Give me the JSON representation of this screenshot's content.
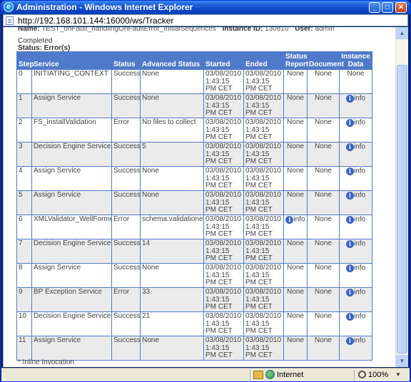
{
  "window": {
    "title": "Administration - Windows Internet Explorer",
    "url": "http://192.168.101.144:16000/ws/Tracker"
  },
  "header": {
    "name_label": "Name:",
    "name_value": "TEST_onFault_handlingOnFaultError_InitialSequences",
    "instance_label": "Instance ID:",
    "instance_value": "130810",
    "user_label": "User:",
    "user_value": "admin",
    "completed": "Completed",
    "status": "Status: Error(s)"
  },
  "table": {
    "columns": [
      "Step",
      "Service",
      "Status",
      "Advanced Status",
      "Started",
      "Ended",
      "Status Report",
      "Document",
      "Instance Data"
    ],
    "rows": [
      {
        "step": "0",
        "service": "INITIATING_CONTEXT",
        "status": "Success",
        "advanced": "None",
        "started": "03/08/2010 1:43:15 PM CET",
        "ended": "03/08/2010 1:43:15 PM CET",
        "report": "None",
        "document": "None",
        "instance": "None"
      },
      {
        "step": "1",
        "service": "Assign Service",
        "status": "Success",
        "advanced": "None",
        "started": "03/08/2010 1:43:15 PM CET",
        "ended": "03/08/2010 1:43:15 PM CET",
        "report": "None",
        "document": "None",
        "instance": "info"
      },
      {
        "step": "2",
        "service": "FS_InstallValidation",
        "status": "Error",
        "advanced": "No files to collect",
        "started": "03/08/2010 1:43:15 PM CET",
        "ended": "03/08/2010 1:43:15 PM CET",
        "report": "None",
        "document": "None",
        "instance": "info"
      },
      {
        "step": "3",
        "service": "Decision Engine Service",
        "status": "Success",
        "advanced": "5",
        "started": "03/08/2010 1:43:15 PM CET",
        "ended": "03/08/2010 1:43:15 PM CET",
        "report": "None",
        "document": "None",
        "instance": "info"
      },
      {
        "step": "4",
        "service": "Assign Service",
        "status": "Success",
        "advanced": "None",
        "started": "03/08/2010 1:43:15 PM CET",
        "ended": "03/08/2010 1:43:15 PM CET",
        "report": "None",
        "document": "None",
        "instance": "info"
      },
      {
        "step": "5",
        "service": "Assign Service",
        "status": "Success",
        "advanced": "None",
        "started": "03/08/2010 1:43:15 PM CET",
        "ended": "03/08/2010 1:43:15 PM CET",
        "report": "None",
        "document": "None",
        "instance": "info"
      },
      {
        "step": "6",
        "service": "XMLValidator_WellFormed",
        "status": "Error",
        "advanced": "schema:validationerr",
        "started": "03/08/2010 1:43:15 PM CET",
        "ended": "03/08/2010 1:43:15 PM CET",
        "report": "info",
        "document": "None",
        "instance": "info"
      },
      {
        "step": "7",
        "service": "Decision Engine Service",
        "status": "Success",
        "advanced": "14",
        "started": "03/08/2010 1:43:15 PM CET",
        "ended": "03/08/2010 1:43:15 PM CET",
        "report": "None",
        "document": "None",
        "instance": "info"
      },
      {
        "step": "8",
        "service": "Assign Service",
        "status": "Success",
        "advanced": "None",
        "started": "03/08/2010 1:43:15 PM CET",
        "ended": "03/08/2010 1:43:15 PM CET",
        "report": "None",
        "document": "None",
        "instance": "info"
      },
      {
        "step": "9",
        "service": "BP Exception Service",
        "status": "Error",
        "advanced": "33",
        "started": "03/08/2010 1:43:15 PM CET",
        "ended": "03/08/2010 1:43:15 PM CET",
        "report": "None",
        "document": "None",
        "instance": "info"
      },
      {
        "step": "10",
        "service": "Decision Engine Service",
        "status": "Success",
        "advanced": "21",
        "started": "03/08/2010 1:43:15 PM CET",
        "ended": "03/08/2010 1:43:15 PM CET",
        "report": "None",
        "document": "None",
        "instance": "info"
      },
      {
        "step": "11",
        "service": "Assign Service",
        "status": "Success",
        "advanced": "None",
        "started": "03/08/2010 1:43:15 PM CET",
        "ended": "03/08/2010 1:43:15 PM CET",
        "report": "None",
        "document": "None",
        "instance": "info"
      }
    ]
  },
  "footnote": "* Inline Invocation",
  "statusbar": {
    "zone": "Internet",
    "zoom": "100%"
  },
  "colors": {
    "header_bg": "#4f7ac9",
    "title_bar": "#0a46c8"
  }
}
